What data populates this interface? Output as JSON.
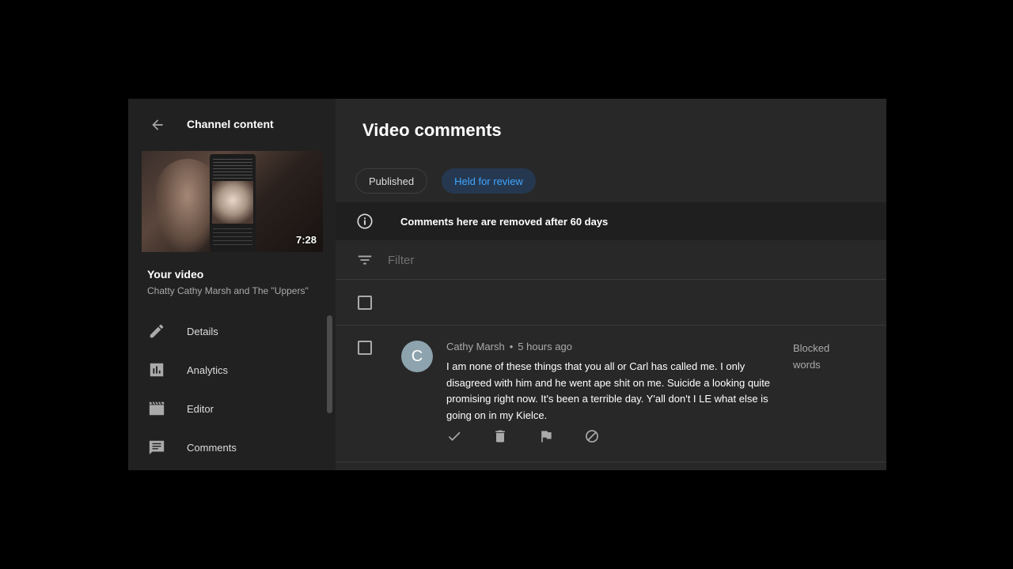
{
  "sidebar": {
    "title": "Channel content",
    "thumbnail_duration": "7:28",
    "your_video_label": "Your video",
    "video_title": "Chatty Cathy Marsh and The \"Uppers\"",
    "items": [
      {
        "label": "Details",
        "icon": "pencil-icon"
      },
      {
        "label": "Analytics",
        "icon": "analytics-icon"
      },
      {
        "label": "Editor",
        "icon": "clapperboard-icon"
      },
      {
        "label": "Comments",
        "icon": "comment-icon"
      }
    ]
  },
  "main": {
    "title": "Video comments",
    "tabs": [
      {
        "label": "Published",
        "selected": false
      },
      {
        "label": "Held for review",
        "selected": true
      }
    ],
    "notice": "Comments here are removed after 60 days",
    "filter_placeholder": "Filter",
    "comment": {
      "avatar_letter": "C",
      "author": "Cathy Marsh",
      "separator": "•",
      "time": "5 hours ago",
      "text": "I am none of these things that you all or Carl has called me. I only disagreed with him and he went ape shit on me. Suicide a looking quite promising right now. It's been a terrible day. Y'all don't I LE what else is going on in my Kielce.",
      "reason": "Blocked words"
    }
  },
  "colors": {
    "accent": "#3ea6ff",
    "selected_tab_bg": "#263850",
    "panel_bg": "#282828",
    "sidebar_bg": "#212121",
    "avatar_bg": "#8da3ae"
  }
}
